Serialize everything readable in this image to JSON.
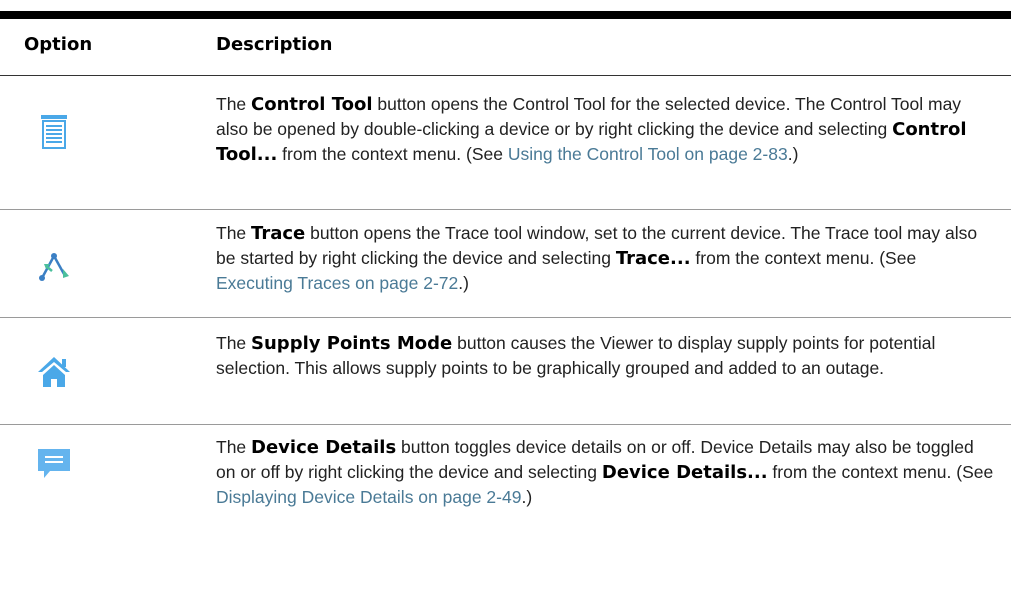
{
  "table": {
    "headers": {
      "option": "Option",
      "description": "Description"
    },
    "rows": [
      {
        "icon": "control-tool-icon",
        "p1": "The ",
        "b1": "Control Tool",
        "p2": " button opens the Control Tool for the selected device. The Control Tool may also be opened by double-clicking a device or by right clicking the device and selecting ",
        "b2": "Control Tool...",
        "p3": " from the context menu. (See ",
        "link": "Using the Control Tool on page 2-83",
        "p4": ".)"
      },
      {
        "icon": "trace-icon",
        "p1": "The ",
        "b1": "Trace",
        "p2": " button opens the Trace tool window, set to the current device. The Trace tool may also be started by right clicking the device and selecting ",
        "b2": "Trace...",
        "p3": " from the context menu. (See ",
        "link": "Executing Traces on page 2-72",
        "p4": ".)"
      },
      {
        "icon": "house-icon",
        "p1": "The ",
        "b1": "Supply Points Mode",
        "p2": " button causes the Viewer to display supply points for potential selection. This allows supply points to be graphically grouped and added to an outage."
      },
      {
        "icon": "speech-bubble-icon",
        "p1": "The ",
        "b1": "Device Details",
        "p2": " button toggles device details on or off. Device Details may also be toggled on or off by right clicking the device and selecting ",
        "b2": "Device Details...",
        "p3": " from the context menu. (See ",
        "link": "Displaying Device Details on page 2-49",
        "p4": ".)"
      }
    ]
  },
  "colors": {
    "icon_blue": "#4aa8e8",
    "link": "#4a7a96"
  }
}
